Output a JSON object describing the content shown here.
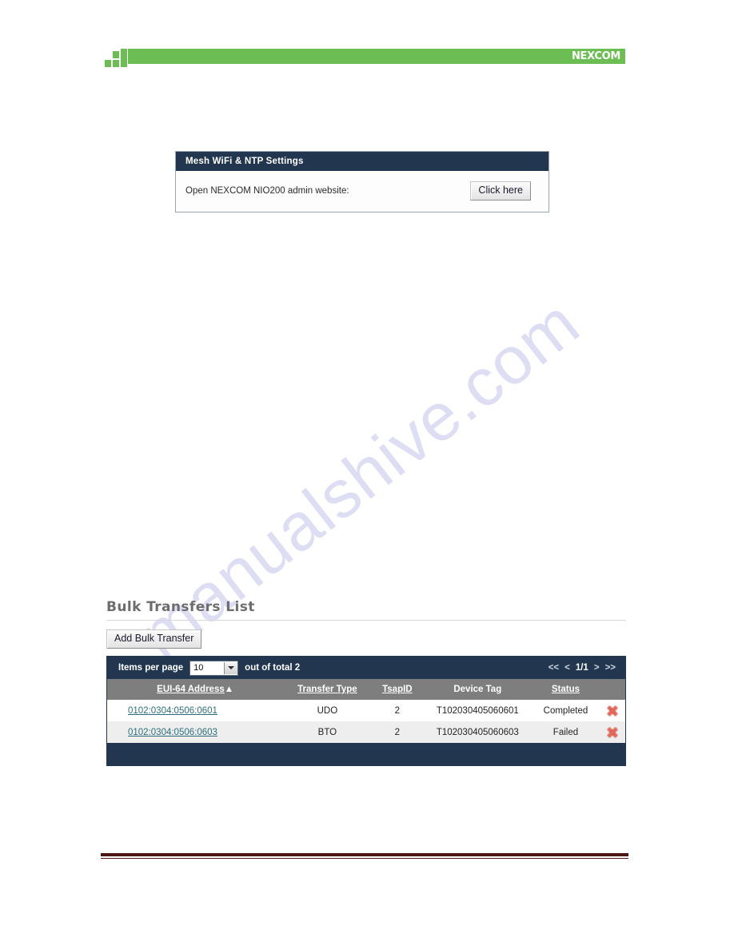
{
  "header": {
    "brand": "NEXCOM",
    "brand_color": "#6cbe54",
    "logo_icon": "nexcom-blocks-icon"
  },
  "watermark": {
    "text": "manualshive.com"
  },
  "settings_panel": {
    "title": "Mesh WiFi & NTP Settings",
    "row_label": "Open NEXCOM NIO200 admin website:",
    "button_label": "Click here",
    "header_color": "#22364f"
  },
  "bulk_transfers": {
    "section_title": "Bulk Transfers List",
    "add_button_label": "Add Bulk Transfer",
    "toolbar": {
      "items_per_page_label": "Items per page",
      "items_per_page_value": "10",
      "items_per_page_options": [
        "10"
      ],
      "total_label": "out of total 2",
      "dropdown_icon": "chevron-down-icon"
    },
    "pagination": {
      "first": "<<",
      "prev": "<",
      "current": "1/1",
      "next": ">",
      "last": ">>"
    },
    "columns": [
      {
        "label": "EUI-64 Address",
        "sorted": true,
        "sort_indicator": "▲",
        "sortable": true
      },
      {
        "label": "Transfer Type",
        "sorted": false,
        "sort_indicator": "",
        "sortable": true
      },
      {
        "label": "TsapID",
        "sorted": false,
        "sort_indicator": "",
        "sortable": true
      },
      {
        "label": "Device Tag",
        "sorted": false,
        "sort_indicator": "",
        "sortable": false
      },
      {
        "label": "Status",
        "sorted": false,
        "sort_indicator": "",
        "sortable": true
      }
    ],
    "rows": [
      {
        "eui64": "0102:0304:0506:0601",
        "transfer_type": "UDO",
        "tsap_id": "2",
        "device_tag": "T102030405060601",
        "status": "Completed",
        "delete_icon": "delete-x-icon"
      },
      {
        "eui64": "0102:0304:0506:0603",
        "transfer_type": "BTO",
        "tsap_id": "2",
        "device_tag": "T102030405060603",
        "status": "Failed",
        "delete_icon": "delete-x-icon"
      }
    ]
  }
}
